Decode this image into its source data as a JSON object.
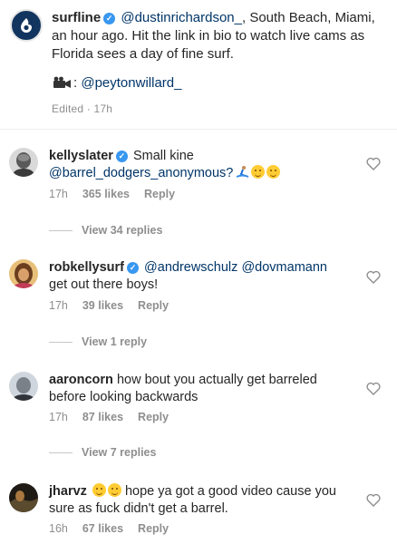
{
  "post": {
    "username": "surfline",
    "mention": "@dustinrichardson_",
    "caption_rest": ", South Beach, Miami, an hour ago. Hit the link in bio to watch live cams as Florida sees a day of fine surf.",
    "credit_prefix": ":",
    "credit_mention": "@peytonwillard_",
    "edited": "Edited · 17h",
    "avatar_icon": "surfline-logo-icon",
    "brand_color": "#12355f"
  },
  "comments": [
    {
      "username": "kellyslater",
      "text_plain": "Small kine",
      "mention": "@barrel_dodgers_anonymous?",
      "time": "17h",
      "likes": "365 likes",
      "reply": "Reply",
      "view_replies": "View 34 replies"
    },
    {
      "username": "robkellysurf",
      "mention1": "@andrewschulz",
      "mention2": "@dovmamann",
      "text_plain": "get out there boys!",
      "time": "17h",
      "likes": "39 likes",
      "reply": "Reply",
      "view_replies": "View 1 reply"
    },
    {
      "username": "aaroncorn",
      "text_plain": "how bout you actually get barreled before looking backwards",
      "time": "17h",
      "likes": "87 likes",
      "reply": "Reply",
      "view_replies": "View 7 replies"
    },
    {
      "username": "jharvz",
      "text_plain": "hope ya got a good video cause you sure as fuck didn't get a barrel.",
      "time": "16h",
      "likes": "67 likes",
      "reply": "Reply"
    }
  ]
}
